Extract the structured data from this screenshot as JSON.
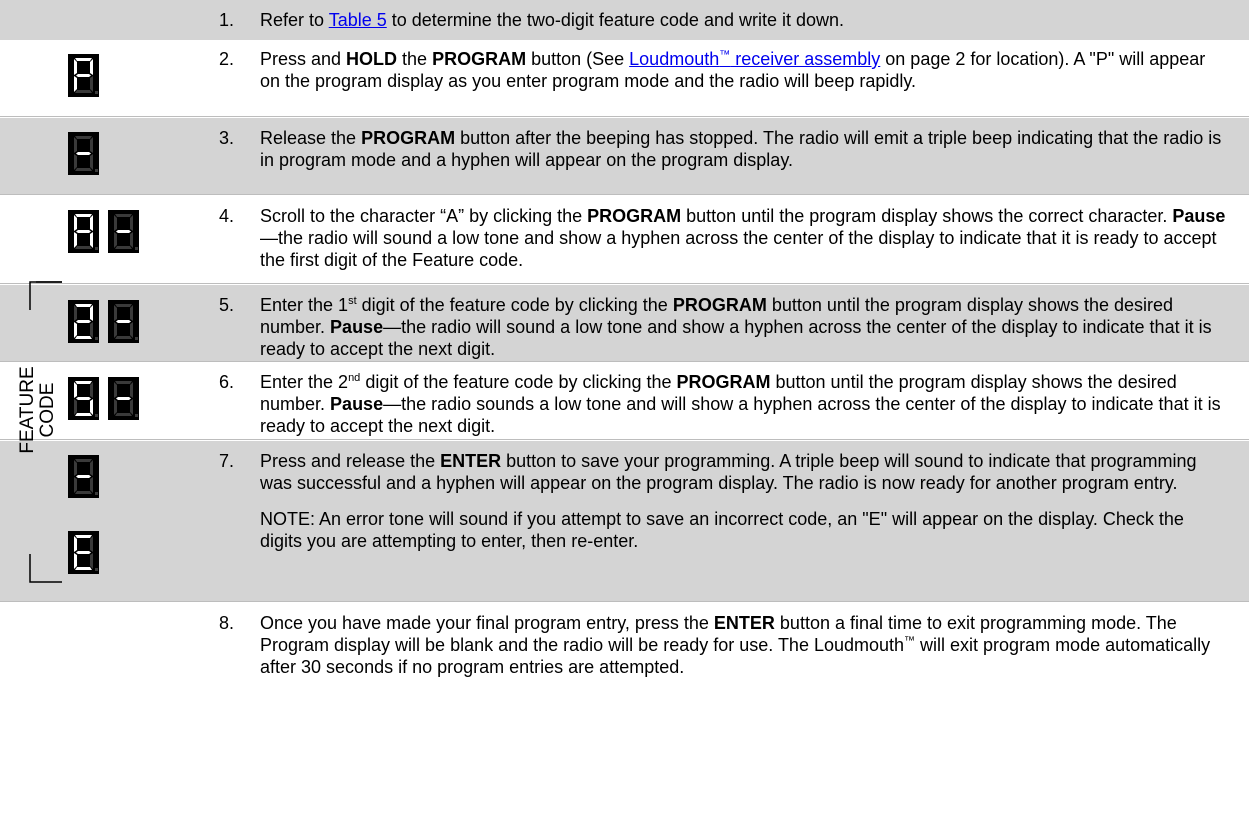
{
  "steps": [
    {
      "n": "1.",
      "pre": "Refer to ",
      "link": "Table 5",
      "post": " to determine the two-digit feature code and write it down."
    },
    {
      "n": "2.",
      "a": "Press and ",
      "b1": "HOLD",
      "c": " the ",
      "b2": "PROGRAM",
      "d": " button (See ",
      "link": "Loudmouth",
      "tm": "™",
      "link2": " receiver assembly",
      "e": " on page 2 for location). A \"P\" will appear on the program display as you enter program mode and the radio will beep rapidly."
    },
    {
      "n": "3.",
      "a": "Release the ",
      "b1": "PROGRAM",
      "c": " button after the beeping has stopped. The radio will emit a triple beep indicating that the radio is in program mode and a hyphen will appear on the program display."
    },
    {
      "n": "4.",
      "a": "Scroll to the character “A” by clicking the ",
      "b1": "PROGRAM",
      "c": " button until the program display shows the correct character. ",
      "b2": "Pause",
      "d": "—the radio will sound a low tone and show a hyphen across the center of the display to indicate that it is ready to accept the first digit of the Feature code."
    },
    {
      "n": "5.",
      "a": "Enter the 1",
      "sup": "st",
      "c": " digit of the feature code by clicking the ",
      "b1": "PROGRAM",
      "d": " button until the program display shows the desired number. ",
      "b2": "Pause",
      "e": "—the radio will sound a low tone and show a hyphen across the center of the display to indicate that it is ready to accept the next digit."
    },
    {
      "n": "6.",
      "a": "Enter the 2",
      "sup": "nd",
      "c": " digit of the feature code by clicking the ",
      "b1": "PROGRAM",
      "d": " button until the program display shows the desired number. ",
      "b2": "Pause",
      "e": "—the radio sounds a low tone and will show a hyphen across the center of the display to indicate that it is ready to accept the next digit."
    },
    {
      "n": "7.",
      "a": "Press and release the ",
      "b1": "ENTER",
      "c": " button to save your programming. A triple beep will sound to indicate that programming was successful and a hyphen will appear on the program display.  The radio is now ready for another program entry.",
      "note": "NOTE:  An error tone will sound if you attempt to save an incorrect code, an \"E\" will appear on the display.  Check the digits you are attempting to enter, then re-enter."
    },
    {
      "n": "8.",
      "a": "Once you have made your final program entry, press the ",
      "b1": "ENTER",
      "c": " button a final time to exit programming mode.  The Program display will be blank and the radio will be ready for use.  The Loudmouth",
      "tm": "™",
      "d": " will exit program mode automatically after 30 seconds if no program entries are attempted."
    }
  ],
  "side_label": {
    "line1": "FEATURE",
    "line2": "CODE"
  },
  "displays": {
    "step2": [
      "P"
    ],
    "step3": [
      "-"
    ],
    "step4": [
      "A",
      "-"
    ],
    "step5": [
      "2",
      "-"
    ],
    "step6": [
      "5",
      "-"
    ],
    "step7": [
      "-",
      "E"
    ]
  },
  "colors": {
    "row_shade": "#d4d4d4",
    "segment_on": "#ffffff",
    "segment_off": "#3a3a3a",
    "display_bg": "#000000",
    "link": "#0000ee"
  }
}
